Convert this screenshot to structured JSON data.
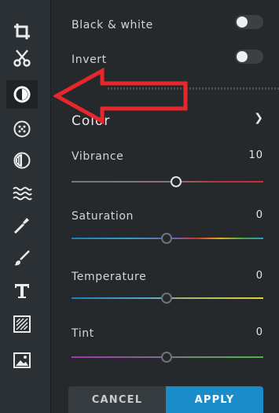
{
  "tools": [
    {
      "name": "crop-icon"
    },
    {
      "name": "scissors-icon"
    },
    {
      "name": "adjust-icon"
    },
    {
      "name": "effects-icon"
    },
    {
      "name": "overlay-icon"
    },
    {
      "name": "texture-icon"
    },
    {
      "name": "brush-icon"
    },
    {
      "name": "paint-brush-icon"
    },
    {
      "name": "text-icon"
    },
    {
      "name": "frame-icon"
    },
    {
      "name": "image-icon"
    }
  ],
  "panel": {
    "black_white": {
      "label": "Black & white",
      "on": false
    },
    "invert": {
      "label": "Invert",
      "on": false
    },
    "section_title": "Color",
    "sliders": {
      "vibrance": {
        "label": "Vibrance",
        "value": "10"
      },
      "saturation": {
        "label": "Saturation",
        "value": "0"
      },
      "temperature": {
        "label": "Temperature",
        "value": "0"
      },
      "tint": {
        "label": "Tint",
        "value": "0"
      }
    }
  },
  "buttons": {
    "cancel": "CANCEL",
    "apply": "APPLY"
  },
  "colors": {
    "accent": "#1a8cc9",
    "arrow": "#e8262b"
  }
}
